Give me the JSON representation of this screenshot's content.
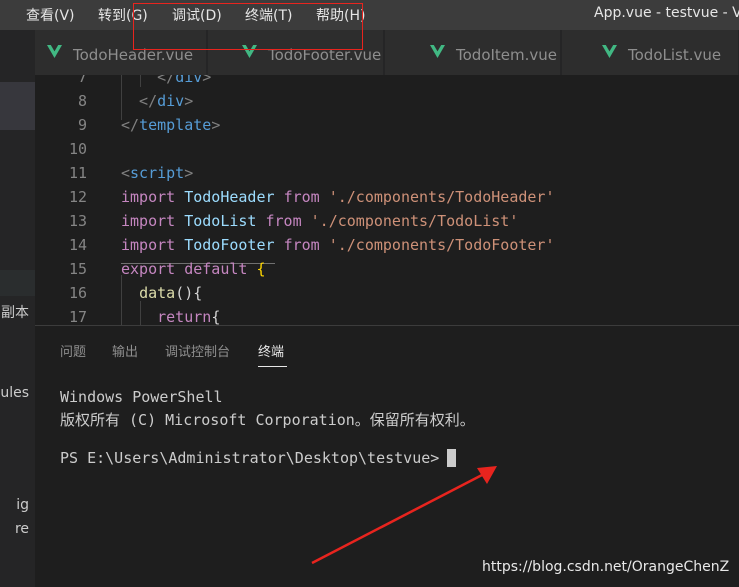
{
  "menubar": {
    "items": [
      "查看(V)",
      "转到(G)",
      "调试(D)",
      "终端(T)",
      "帮助(H)"
    ],
    "window_title": "App.vue - testvue - Vis"
  },
  "sidebar": {
    "fragments": [
      "副本",
      "ules",
      "ig",
      "re"
    ]
  },
  "tabs": [
    {
      "label": "TodoHeader.vue",
      "icon": "vue-icon"
    },
    {
      "label": "TodoFooter.vue",
      "icon": "vue-icon"
    },
    {
      "label": "TodoItem.vue",
      "icon": "vue-icon"
    },
    {
      "label": "TodoList.vue",
      "icon": "vue-icon"
    }
  ],
  "editor": {
    "lines": [
      {
        "num": "7",
        "tokens": [
          [
            "tok-punct",
            "    </"
          ],
          [
            "tok-tag",
            "div"
          ],
          [
            "tok-punct",
            ">"
          ]
        ]
      },
      {
        "num": "8",
        "tokens": [
          [
            "tok-punct",
            "  </"
          ],
          [
            "tok-tag",
            "div"
          ],
          [
            "tok-punct",
            ">"
          ]
        ]
      },
      {
        "num": "9",
        "tokens": [
          [
            "tok-punct",
            "</"
          ],
          [
            "tok-tag",
            "template"
          ],
          [
            "tok-punct",
            ">"
          ]
        ]
      },
      {
        "num": "10",
        "tokens": []
      },
      {
        "num": "11",
        "tokens": [
          [
            "tok-punct",
            "<"
          ],
          [
            "tok-tag",
            "script"
          ],
          [
            "tok-punct",
            ">"
          ]
        ]
      },
      {
        "num": "12",
        "tokens": [
          [
            "tok-kw",
            "import "
          ],
          [
            "tok-ident",
            "TodoHeader "
          ],
          [
            "tok-kw",
            "from "
          ],
          [
            "tok-str",
            "'./components/TodoHeader'"
          ]
        ]
      },
      {
        "num": "13",
        "tokens": [
          [
            "tok-kw",
            "import "
          ],
          [
            "tok-ident",
            "TodoList "
          ],
          [
            "tok-kw",
            "from "
          ],
          [
            "tok-str",
            "'./components/TodoList'"
          ]
        ]
      },
      {
        "num": "14",
        "tokens": [
          [
            "tok-kw",
            "import "
          ],
          [
            "tok-ident",
            "TodoFooter "
          ],
          [
            "tok-kw",
            "from "
          ],
          [
            "tok-str",
            "'./components/TodoFooter'"
          ]
        ]
      },
      {
        "num": "15",
        "tokens": [
          [
            "tok-kw",
            "export default "
          ],
          [
            "tok-brace",
            "{"
          ]
        ]
      },
      {
        "num": "16",
        "tokens": [
          [
            "tok-plain",
            "  "
          ],
          [
            "tok-fn",
            "data"
          ],
          [
            "tok-plain",
            "(){"
          ]
        ]
      },
      {
        "num": "17",
        "tokens": [
          [
            "tok-plain",
            "    "
          ],
          [
            "tok-kw",
            "return"
          ],
          [
            "tok-plain",
            "{"
          ]
        ]
      }
    ]
  },
  "panel": {
    "tabs": [
      "问题",
      "输出",
      "调试控制台",
      "终端"
    ],
    "active_tab": "终端",
    "terminal_lines": [
      "Windows PowerShell",
      "版权所有 (C) Microsoft Corporation。保留所有权利。",
      "",
      "PS E:\\Users\\Administrator\\Desktop\\testvue> "
    ]
  },
  "watermark": "https://blog.csdn.net/OrangeChenZ",
  "colors": {
    "accent_red": "#e8241e",
    "vue_green": "#41b883",
    "editor_bg": "#1e1e1e"
  }
}
